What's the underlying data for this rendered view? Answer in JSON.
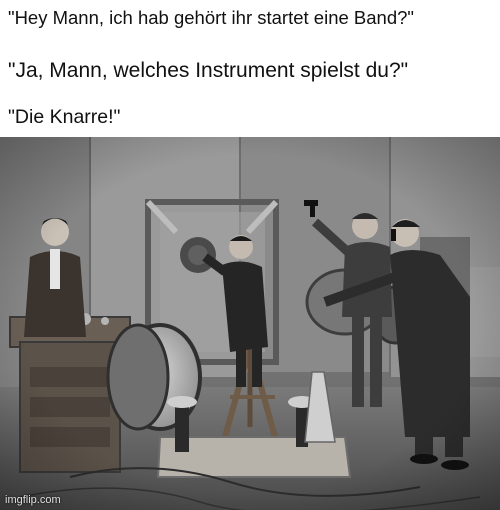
{
  "captions": {
    "line1": "\"Hey Mann, ich hab gehört ihr startet eine Band?\"",
    "line2": "\"Ja, Mann, welches Instrument spielst du?\"",
    "line3": "\"Die Knarre!\""
  },
  "photo": {
    "style": "black-and-white",
    "subject": "men in suits making sound effects with drums, gong, pistol and noise machines"
  },
  "watermark": "imgflip.com",
  "colors": {
    "background": "#ffffff",
    "caption_text": "#111111"
  }
}
